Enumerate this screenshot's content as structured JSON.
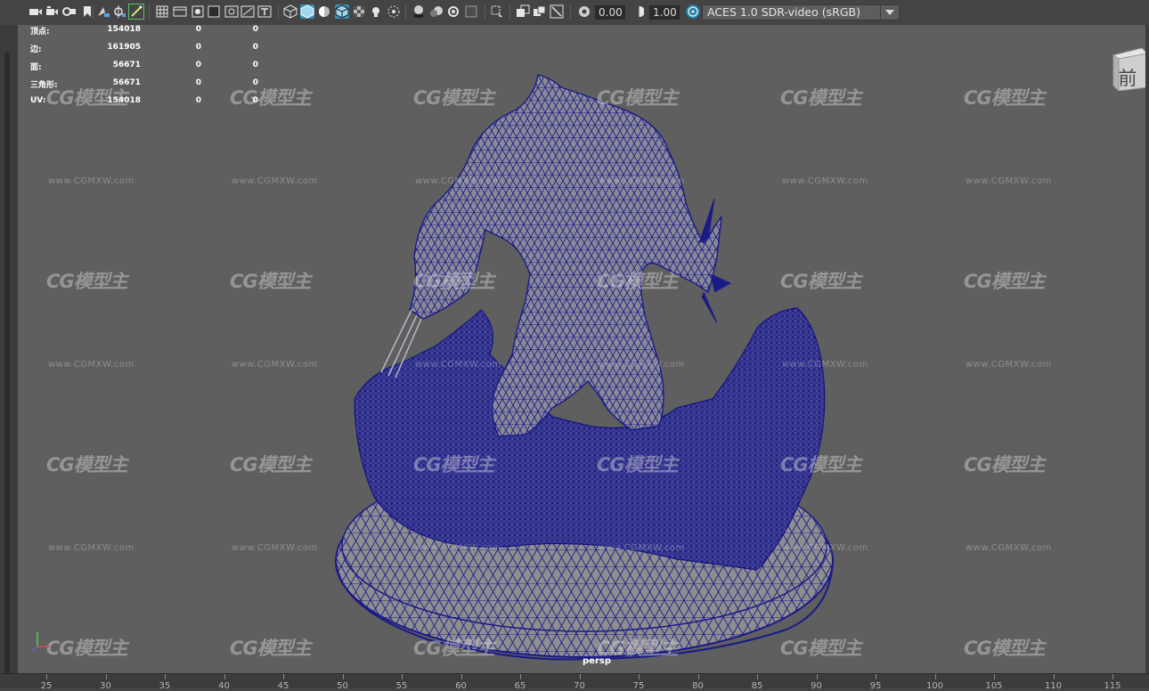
{
  "toolbar": {
    "exposure_value": "0.00",
    "gamma_value": "1.00",
    "color_space": "ACES 1.0 SDR-video (sRGB)",
    "icons": [
      "camera-icon",
      "camera-attributes-icon",
      "bookmark-icon",
      "snap-camera-icon",
      "image-plane-icon",
      "grid-icon",
      "film-gate-icon",
      "resolution-gate-icon",
      "gate-mask-icon",
      "field-chart-icon",
      "safe-action-icon",
      "safe-title-icon",
      "wireframe-icon",
      "smooth-shade-icon",
      "default-lighting-icon",
      "wireframe-on-shaded-icon",
      "xray-icon",
      "lighting-icon",
      "shadows-icon",
      "ambient-occlusion-icon",
      "motion-blur-icon",
      "anti-aliasing-icon",
      "isolate-select-icon",
      "xray-joints-icon",
      "xray-active-icon",
      "gamma-icon",
      "exposure-icon",
      "color-management-icon"
    ]
  },
  "stats": {
    "rows": [
      {
        "label": "顶点:",
        "v1": "154018",
        "v2": "0",
        "v3": "0"
      },
      {
        "label": "边:",
        "v1": "161905",
        "v2": "0",
        "v3": "0"
      },
      {
        "label": "面:",
        "v1": "56671",
        "v2": "0",
        "v3": "0"
      },
      {
        "label": "三角形:",
        "v1": "56671",
        "v2": "0",
        "v3": "0"
      },
      {
        "label": "UV:",
        "v1": "154018",
        "v2": "0",
        "v3": "0"
      }
    ]
  },
  "watermark": {
    "logo": "CG模型主",
    "url": "www.CGMXW.com"
  },
  "view_cube": {
    "label": "前"
  },
  "viewport": {
    "camera_name": "persp"
  },
  "ruler": {
    "labels": [
      "25",
      "30",
      "35",
      "40",
      "45",
      "50",
      "55",
      "60",
      "65",
      "70",
      "75",
      "80",
      "85",
      "90",
      "95",
      "100",
      "105",
      "110",
      "115"
    ]
  },
  "colors": {
    "viewport_bg": "#5f5f5f",
    "wireframe": "#1c1c8c",
    "mesh_fill": "#8a8a8a",
    "active_tool": "#3a8fb7"
  }
}
